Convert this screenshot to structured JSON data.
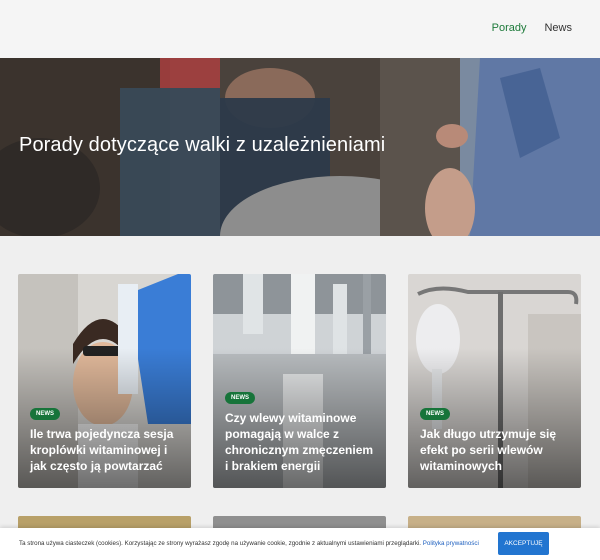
{
  "nav": {
    "items": [
      {
        "label": "Porady",
        "active": true
      },
      {
        "label": "News",
        "active": false
      }
    ]
  },
  "hero": {
    "title": "Porady dotyczące walki z uzależnieniami"
  },
  "cards": [
    {
      "badge": "NEWS",
      "title": "Ile trwa pojedyncza sesja kroplówki witaminowej i jak często ją powtarzać"
    },
    {
      "badge": "NEWS",
      "title": "Czy wlewy witaminowe pomagają w walce z chronicznym zmęczeniem i brakiem energii"
    },
    {
      "badge": "NEWS",
      "title": "Jak długo utrzymuje się efekt po serii wlewów witaminowych"
    }
  ],
  "cookie": {
    "text": "Ta strona używa ciasteczek (cookies). Korzystając ze strony wyrażasz zgodę na używanie cookie, zgodnie z aktualnymi ustawieniami przeglądarki.",
    "link": "Polityka prywatności",
    "button": "AKCEPTUJĘ"
  },
  "colors": {
    "accent": "#1d7a3a",
    "badge": "#17743a",
    "cookie_button": "#2275d0"
  }
}
